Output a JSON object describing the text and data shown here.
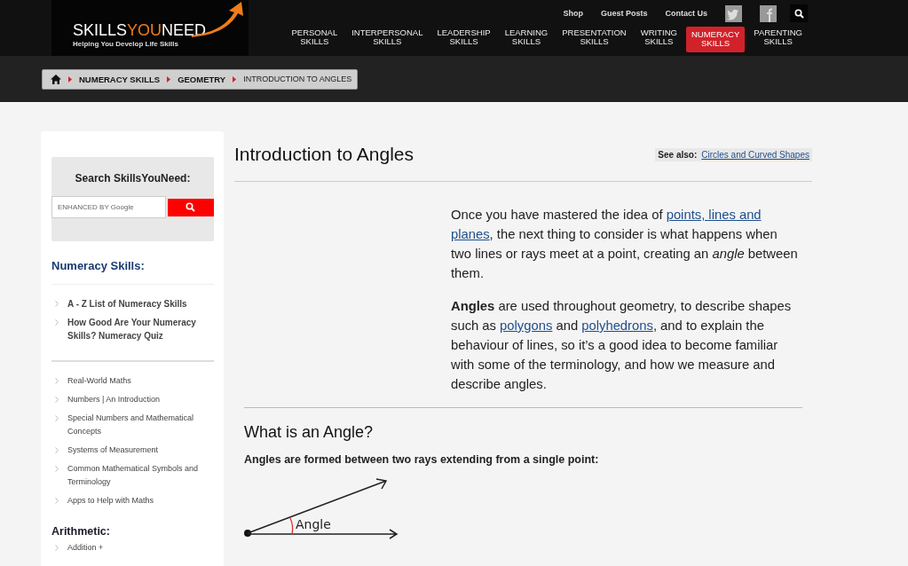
{
  "header": {
    "logo": {
      "word_1": "SKILLS",
      "word_2": "YOU",
      "word_3": "NEED",
      "tagline": "Helping You Develop Life Skills"
    },
    "top_links": [
      "Shop",
      "Guest Posts",
      "Contact Us"
    ],
    "nav": [
      {
        "label": "PERSONAL\nSKILLS",
        "selected": false
      },
      {
        "label": "INTERPERSONAL\nSKILLS",
        "selected": false
      },
      {
        "label": "LEADERSHIP\nSKILLS",
        "selected": false
      },
      {
        "label": "LEARNING\nSKILLS",
        "selected": false
      },
      {
        "label": "PRESENTATION\nSKILLS",
        "selected": false
      },
      {
        "label": "WRITING\nSKILLS",
        "selected": false
      },
      {
        "label": "NUMERACY\nSKILLS",
        "selected": true
      },
      {
        "label": "PARENTING\nSKILLS",
        "selected": false
      }
    ]
  },
  "breadcrumb": [
    {
      "label": "NUMERACY SKILLS",
      "kind": "link"
    },
    {
      "label": "GEOMETRY",
      "kind": "link"
    },
    {
      "label": "INTRODUCTION TO ANGLES",
      "kind": "current"
    }
  ],
  "sidebar": {
    "search": {
      "title": "Search SkillsYouNeed:",
      "placeholder": "ENHANCED BY Google"
    },
    "sections": [
      {
        "heading": "Numeracy Skills:",
        "kind": "primary",
        "lists": [
          {
            "kind": "bold",
            "items": [
              "A - Z List of Numeracy Skills",
              "How Good Are Your Numeracy Skills? Numeracy Quiz"
            ]
          },
          {
            "kind": "plain",
            "items": [
              "Real-World Maths",
              "Numbers | An Introduction",
              "Special Numbers and Mathematical Concepts",
              "Systems of Measurement",
              "Common Mathematical Symbols and Terminology",
              "Apps to Help with Maths"
            ]
          }
        ]
      },
      {
        "heading": "Arithmetic:",
        "kind": "secondary",
        "lists": [
          {
            "kind": "plain",
            "items": [
              "Addition +"
            ]
          }
        ]
      }
    ]
  },
  "article": {
    "title": "Introduction to Angles",
    "see_also": {
      "label": "See also:",
      "link": "Circles and Curved Shapes"
    },
    "paragraphs": [
      [
        {
          "kind": "text",
          "text": "Once you have mastered the idea of "
        },
        {
          "kind": "link",
          "text": "points, lines and"
        },
        {
          "kind": "link",
          "text": "planes"
        },
        {
          "kind": "text",
          "text": ", the next thing to consider is what happens when two lines or rays meet at a point, creating an *angle* between them."
        }
      ],
      [
        {
          "kind": "text",
          "text": "**Angles** are used throughout geometry, to describe shapes such as "
        },
        {
          "kind": "link",
          "text": "polygons"
        },
        {
          "kind": "text",
          "text": " and "
        },
        {
          "kind": "link",
          "text": "polyhedrons"
        },
        {
          "kind": "text",
          "text": ", and to explain the behaviour of lines, so it’s a good idea to become familiar with some of the terminology, and how we measure and describe angles."
        }
      ]
    ],
    "section": {
      "heading": "What is an Angle?",
      "lead": "Angles are formed between two rays extending from a single point:",
      "diagram_label": "Angle"
    }
  }
}
